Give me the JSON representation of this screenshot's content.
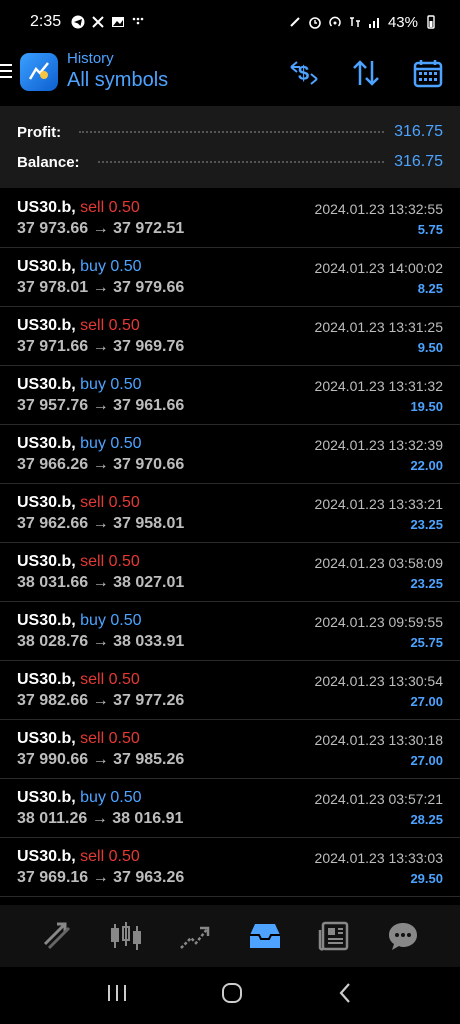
{
  "status_bar": {
    "time": "2:35",
    "battery": "43%"
  },
  "header": {
    "subtitle": "History",
    "title": "All symbols"
  },
  "summary": {
    "profit_label": "Profit:",
    "profit_value": "316.75",
    "balance_label": "Balance:",
    "balance_value": "316.75"
  },
  "trades": [
    {
      "symbol": "US30.b,",
      "side": "sell 0.50",
      "type": "sell",
      "prices": "37 973.66 → 37 972.51",
      "datetime": "2024.01.23 13:32:55",
      "profit": "5.75"
    },
    {
      "symbol": "US30.b,",
      "side": "buy 0.50",
      "type": "buy",
      "prices": "37 978.01 → 37 979.66",
      "datetime": "2024.01.23 14:00:02",
      "profit": "8.25"
    },
    {
      "symbol": "US30.b,",
      "side": "sell 0.50",
      "type": "sell",
      "prices": "37 971.66 → 37 969.76",
      "datetime": "2024.01.23 13:31:25",
      "profit": "9.50"
    },
    {
      "symbol": "US30.b,",
      "side": "buy 0.50",
      "type": "buy",
      "prices": "37 957.76 → 37 961.66",
      "datetime": "2024.01.23 13:31:32",
      "profit": "19.50"
    },
    {
      "symbol": "US30.b,",
      "side": "buy 0.50",
      "type": "buy",
      "prices": "37 966.26 → 37 970.66",
      "datetime": "2024.01.23 13:32:39",
      "profit": "22.00"
    },
    {
      "symbol": "US30.b,",
      "side": "sell 0.50",
      "type": "sell",
      "prices": "37 962.66 → 37 958.01",
      "datetime": "2024.01.23 13:33:21",
      "profit": "23.25"
    },
    {
      "symbol": "US30.b,",
      "side": "sell 0.50",
      "type": "sell",
      "prices": "38 031.66 → 38 027.01",
      "datetime": "2024.01.23 03:58:09",
      "profit": "23.25"
    },
    {
      "symbol": "US30.b,",
      "side": "buy 0.50",
      "type": "buy",
      "prices": "38 028.76 → 38 033.91",
      "datetime": "2024.01.23 09:59:55",
      "profit": "25.75"
    },
    {
      "symbol": "US30.b,",
      "side": "sell 0.50",
      "type": "sell",
      "prices": "37 982.66 → 37 977.26",
      "datetime": "2024.01.23 13:30:54",
      "profit": "27.00"
    },
    {
      "symbol": "US30.b,",
      "side": "sell 0.50",
      "type": "sell",
      "prices": "37 990.66 → 37 985.26",
      "datetime": "2024.01.23 13:30:18",
      "profit": "27.00"
    },
    {
      "symbol": "US30.b,",
      "side": "buy 0.50",
      "type": "buy",
      "prices": "38 011.26 → 38 016.91",
      "datetime": "2024.01.23 03:57:21",
      "profit": "28.25"
    },
    {
      "symbol": "US30.b,",
      "side": "sell 0.50",
      "type": "sell",
      "prices": "37 969.16 → 37 963.26",
      "datetime": "2024.01.23 13:33:03",
      "profit": "29.50"
    }
  ],
  "colors": {
    "accent": "#4da3ff",
    "sell": "#e53935",
    "buy": "#4da3ff"
  },
  "bottom_nav": [
    "quotes-icon",
    "chart-icon",
    "trade-icon",
    "history-icon",
    "news-icon",
    "chat-icon"
  ]
}
